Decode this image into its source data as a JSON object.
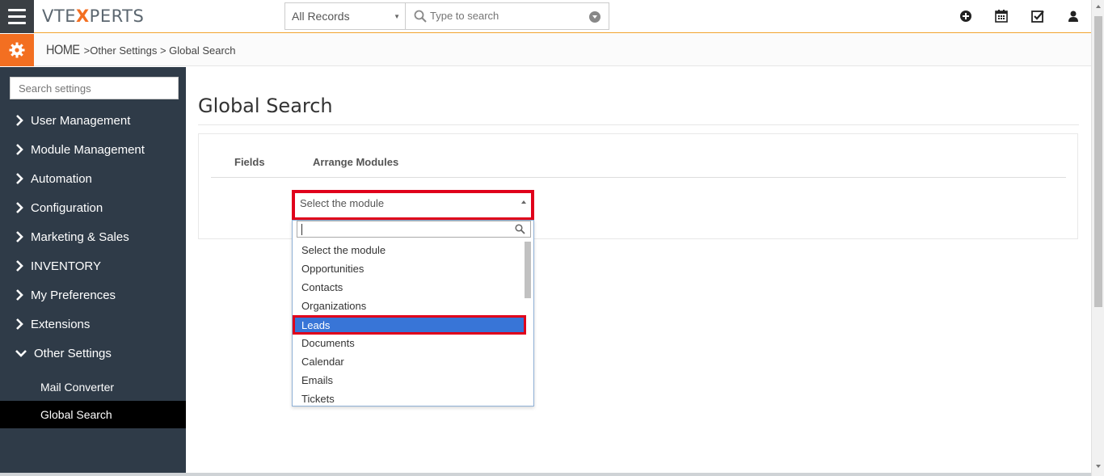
{
  "header": {
    "logo_part1": "VTE",
    "logo_x": "X",
    "logo_part2": "PERTS",
    "records_select": "All Records",
    "search_placeholder": "Type to search",
    "icons": [
      "plus-circle-icon",
      "calendar-icon",
      "checkbox-icon",
      "user-icon"
    ]
  },
  "breadcrumb": {
    "home": "HOME",
    "sep1": " >",
    "item1": "Other Settings",
    "sep2": " > ",
    "item2": "Global Search"
  },
  "sidebar": {
    "search_placeholder": "Search settings",
    "items": [
      {
        "label": "User Management"
      },
      {
        "label": "Module Management"
      },
      {
        "label": "Automation"
      },
      {
        "label": "Configuration"
      },
      {
        "label": "Marketing & Sales"
      },
      {
        "label": "INVENTORY"
      },
      {
        "label": "My Preferences"
      },
      {
        "label": "Extensions"
      },
      {
        "label": "Other Settings"
      }
    ],
    "subitems": [
      {
        "label": "Mail Converter"
      },
      {
        "label": "Global Search"
      }
    ]
  },
  "main": {
    "title": "Global Search",
    "tabs": [
      {
        "label": "Fields"
      },
      {
        "label": "Arrange Modules"
      }
    ],
    "module_select": "Select the module",
    "options": [
      "Select the module",
      "Opportunities",
      "Contacts",
      "Organizations",
      "Leads",
      "Documents",
      "Calendar",
      "Emails",
      "Tickets"
    ],
    "selected_option": "Leads"
  },
  "colors": {
    "accent_orange": "#f36f21",
    "sidebar_bg": "#2f3b48",
    "highlight_red": "#e0001b",
    "selected_blue": "#3875d7"
  }
}
